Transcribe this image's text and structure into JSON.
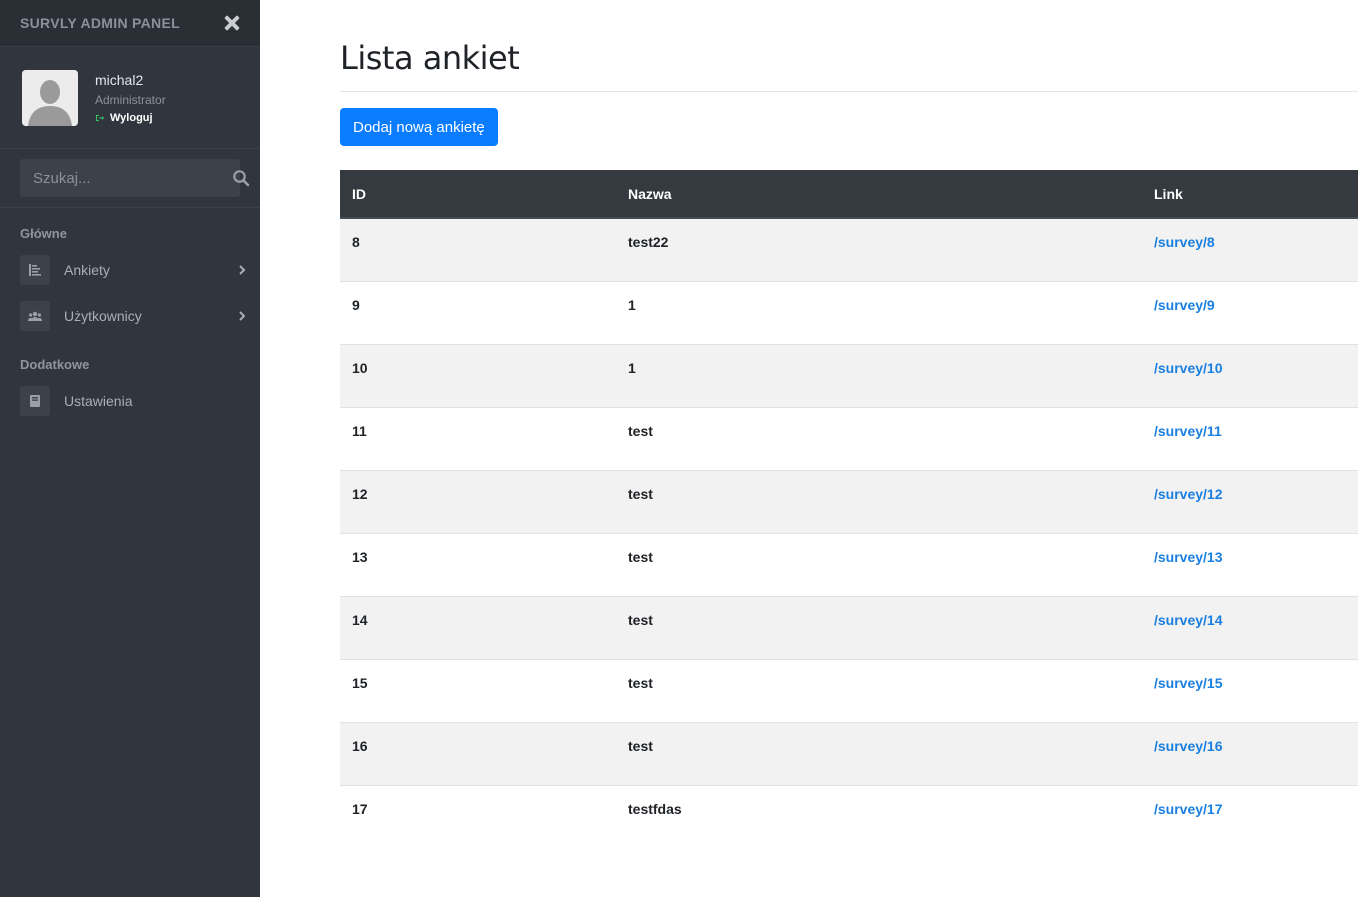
{
  "sidebar": {
    "brand": "SURVLY ADMIN PANEL",
    "user": {
      "name": "michal2",
      "role": "Administrator",
      "logout": "Wyloguj"
    },
    "search": {
      "placeholder": "Szukaj..."
    },
    "sections": {
      "main": "Główne",
      "extra": "Dodatkowe"
    },
    "items": [
      {
        "label": "Ankiety",
        "icon": "list-icon"
      },
      {
        "label": "Użytkownicy",
        "icon": "users-icon"
      },
      {
        "label": "Ustawienia",
        "icon": "book-icon"
      }
    ]
  },
  "main": {
    "title": "Lista ankiet",
    "add_button": "Dodaj nową ankietę",
    "table": {
      "headers": [
        "ID",
        "Nazwa",
        "Link"
      ],
      "rows": [
        {
          "id": "8",
          "name": "test22",
          "link": "/survey/8"
        },
        {
          "id": "9",
          "name": "1",
          "link": "/survey/9"
        },
        {
          "id": "10",
          "name": "1",
          "link": "/survey/10"
        },
        {
          "id": "11",
          "name": "test",
          "link": "/survey/11"
        },
        {
          "id": "12",
          "name": "test",
          "link": "/survey/12"
        },
        {
          "id": "13",
          "name": "test",
          "link": "/survey/13"
        },
        {
          "id": "14",
          "name": "test",
          "link": "/survey/14"
        },
        {
          "id": "15",
          "name": "test",
          "link": "/survey/15"
        },
        {
          "id": "16",
          "name": "test",
          "link": "/survey/16"
        },
        {
          "id": "17",
          "name": "testfdas",
          "link": "/survey/17"
        }
      ]
    }
  },
  "colors": {
    "sidebar_bg": "#31353d",
    "accent": "#0a7cff",
    "link": "#1a7fe0",
    "table_header": "#343a40"
  }
}
